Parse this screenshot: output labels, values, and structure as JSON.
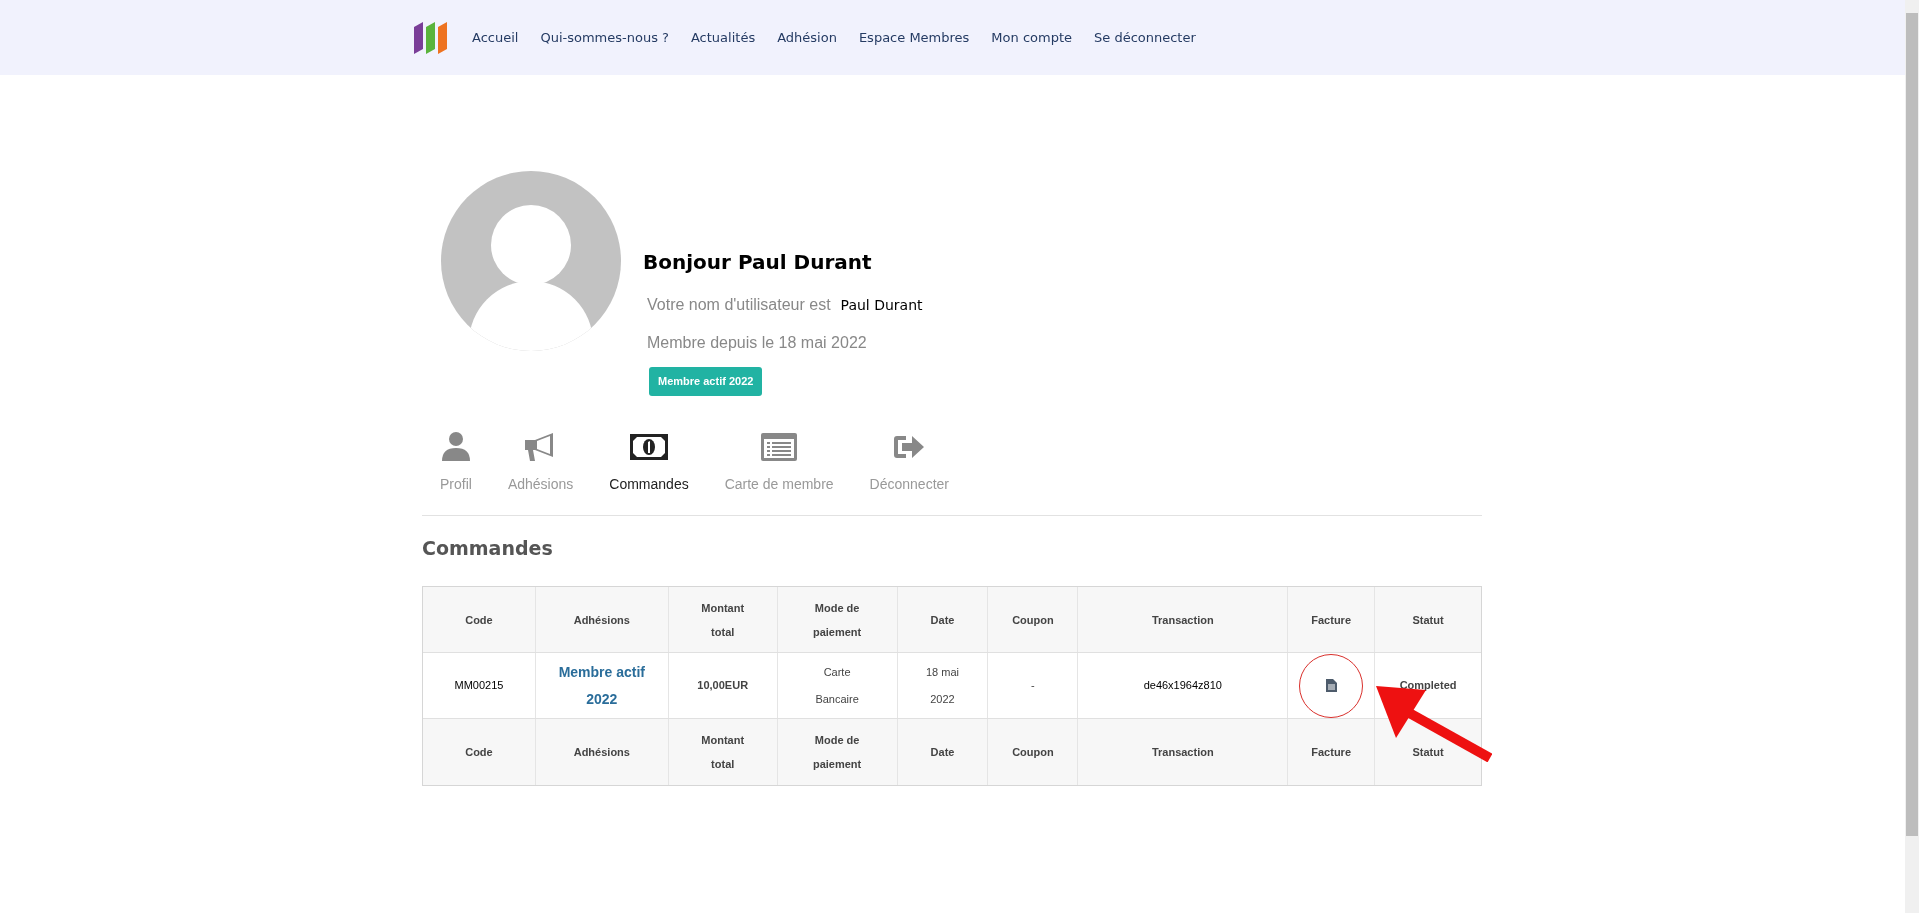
{
  "nav": {
    "items": [
      "Accueil",
      "Qui-sommes-nous ?",
      "Actualités",
      "Adhésion",
      "Espace Membres",
      "Mon compte",
      "Se déconnecter"
    ]
  },
  "profile": {
    "greeting": "Bonjour Paul Durant",
    "username_label": "Votre nom d'utilisateur est",
    "username": "Paul Durant",
    "member_since": "Membre depuis le 18 mai 2022",
    "badge": "Membre actif 2022"
  },
  "tabs": [
    {
      "kind": "user",
      "label": "Profil",
      "selected": false
    },
    {
      "kind": "megaphone",
      "label": "Adhésions",
      "selected": false
    },
    {
      "kind": "money",
      "label": "Commandes",
      "selected": true
    },
    {
      "kind": "card",
      "label": "Carte de membre",
      "selected": false
    },
    {
      "kind": "logout",
      "label": "Déconnecter",
      "selected": false
    }
  ],
  "section_title": "Commandes",
  "table": {
    "columns": [
      [
        "Code"
      ],
      [
        "Adhésions"
      ],
      [
        "Montant",
        "total"
      ],
      [
        "Mode de",
        "paiement"
      ],
      [
        "Date"
      ],
      [
        "Coupon"
      ],
      [
        "Transaction"
      ],
      [
        "Facture"
      ],
      [
        "Statut"
      ]
    ],
    "rows": [
      {
        "code": "MM00215",
        "adhesion": [
          "Membre actif",
          "2022"
        ],
        "amount": "10,00EUR",
        "payment": [
          "Carte",
          "Bancaire"
        ],
        "date": [
          "18 mai",
          "2022"
        ],
        "coupon": "-",
        "transaction": "de46x1964z810",
        "status": "Completed"
      }
    ],
    "footer_columns": [
      [
        "Code"
      ],
      [
        "Adhésions"
      ],
      [
        "Montant",
        "total"
      ],
      [
        "Mode de",
        "paiement"
      ],
      [
        "Date"
      ],
      [
        "Coupon"
      ],
      [
        "Transaction"
      ],
      [
        "Facture"
      ],
      [
        "Statut"
      ]
    ]
  }
}
